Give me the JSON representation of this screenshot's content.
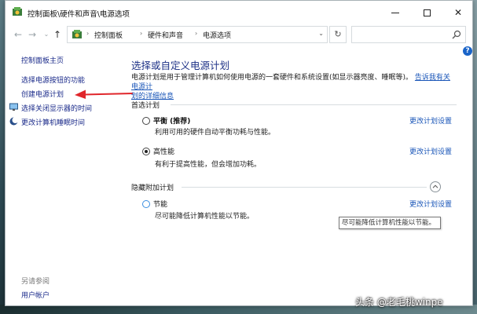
{
  "window": {
    "title": "控制面板\\硬件和声音\\电源选项"
  },
  "address_bar": {
    "crumbs": [
      "控制面板",
      "硬件和声音",
      "电源选项"
    ],
    "search_placeholder": ""
  },
  "sidebar": {
    "home_label": "控制面板主页",
    "items": [
      {
        "label": "选择电源按钮的功能",
        "icon": null
      },
      {
        "label": "创建电源计划",
        "icon": null
      },
      {
        "label": "选择关闭显示器的时间",
        "icon": "display-icon"
      },
      {
        "label": "更改计算机睡眠时间",
        "icon": "moon-icon"
      }
    ],
    "see_also_label": "另请参阅",
    "user_accounts_label": "用户帐户"
  },
  "main": {
    "title": "选择或自定义电源计划",
    "description": "电源计划是用于管理计算机如何使用电源的一套硬件和系统设置(如显示器亮度、睡眠等)。",
    "description_link_line1": "告诉我有关电源计",
    "description_link_line2": "划的详细信息",
    "preferred_group_label": "首选计划",
    "hidden_group_label": "隐藏附加计划",
    "plans": [
      {
        "name": "平衡 (推荐)",
        "description": "利用可用的硬件自动平衡功耗与性能。",
        "link": "更改计划设置",
        "selected": false
      },
      {
        "name": "高性能",
        "description": "有利于提高性能，但会增加功耗。",
        "link": "更改计划设置",
        "selected": true
      },
      {
        "name": "节能",
        "description": "尽可能降低计算机性能以节能。",
        "link": "更改计划设置",
        "selected": false
      }
    ],
    "tooltip": "尽可能降低计算机性能以节能。"
  },
  "watermark": "头条 @老毛桃winpe",
  "colors": {
    "link": "#1a56b8",
    "title": "#1e3287",
    "arrow": "#e0262b",
    "help": "#1a64c8"
  }
}
